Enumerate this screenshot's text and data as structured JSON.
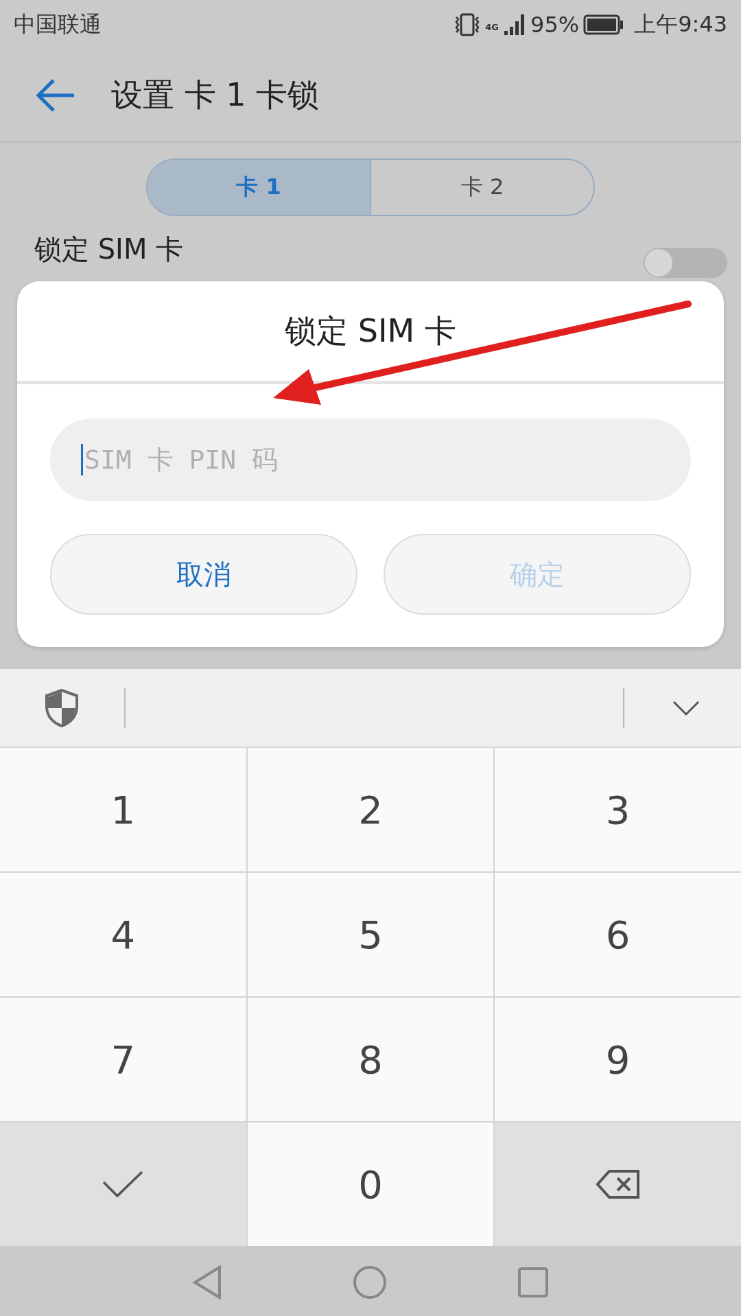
{
  "status_bar": {
    "carrier": "中国联通",
    "network": "4G",
    "battery": "95%",
    "time": "上午9:43"
  },
  "toolbar": {
    "title": "设置 卡 1 卡锁"
  },
  "tabs": [
    {
      "label": "卡 1",
      "selected": true
    },
    {
      "label": "卡 2",
      "selected": false
    }
  ],
  "settings": [
    {
      "label": "锁定 SIM 卡",
      "on": false
    }
  ],
  "dialog": {
    "title": "锁定 SIM 卡",
    "pin_field": {
      "placeholder": "SIM 卡 PIN 码"
    },
    "buttons": [
      {
        "label": "取消",
        "disabled": false
      },
      {
        "label": "确定",
        "disabled": true
      }
    ]
  },
  "keypad": [
    {
      "kind": "digit",
      "label": "1"
    },
    {
      "kind": "digit",
      "label": "2"
    },
    {
      "kind": "digit",
      "label": "3"
    },
    {
      "kind": "digit",
      "label": "4"
    },
    {
      "kind": "digit",
      "label": "5"
    },
    {
      "kind": "digit",
      "label": "6"
    },
    {
      "kind": "digit",
      "label": "7"
    },
    {
      "kind": "digit",
      "label": "8"
    },
    {
      "kind": "digit",
      "label": "9"
    },
    {
      "kind": "done"
    },
    {
      "kind": "digit",
      "label": "0"
    },
    {
      "kind": "delete"
    }
  ]
}
